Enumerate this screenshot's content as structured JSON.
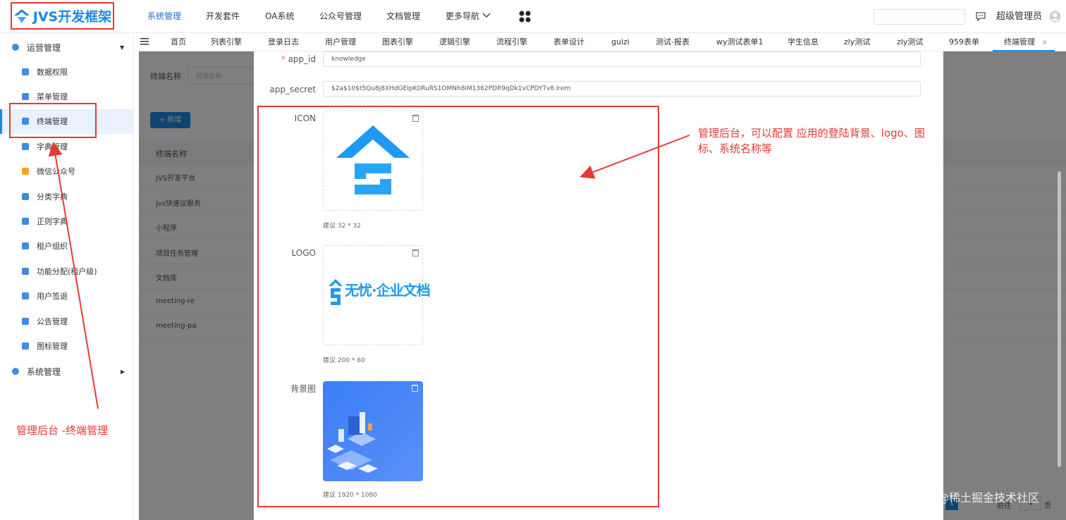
{
  "app": {
    "logo_text": "JVS开发框架"
  },
  "topnav": {
    "items": [
      "系统管理",
      "开发套件",
      "OA系统",
      "公众号管理",
      "文档管理",
      "更多导航"
    ],
    "active": "系统管理",
    "user": "超级管理员"
  },
  "tabs": [
    "首页",
    "列表引擎",
    "登录日志",
    "用户管理",
    "图表引擎",
    "逻辑引擎",
    "流程引擎",
    "表单设计",
    "guizi",
    "测试-报表",
    "wy测试表单1",
    "学生信息",
    "zly测试",
    "zly测试",
    "959表单",
    "终端管理"
  ],
  "sidebar": {
    "group1": "运营管理",
    "items": [
      "数据权限",
      "菜单管理",
      "终端管理",
      "字典管理",
      "微信公众号",
      "分类字典",
      "正则字典",
      "租户组织",
      "功能分配(租户级)",
      "用户签退",
      "公告管理",
      "图标管理"
    ],
    "active_index": 2,
    "icon_colors": [
      "#3a8ee6",
      "#3a8ee6",
      "#3a8ee6",
      "#3a8ee6",
      "#f5a623",
      "#3a8ee6",
      "#3a8ee6",
      "#3a8ee6",
      "#3a8ee6",
      "#3a8ee6",
      "#3a8ee6",
      "#3a8ee6"
    ],
    "group2": "系统管理"
  },
  "list_page": {
    "search_label": "终端名称",
    "search_placeholder": "终端名称",
    "add_button": "+ 新增",
    "column_header": "终端名称",
    "rows": [
      "JVS开发平台",
      "jvs快速议服务",
      "小程序",
      "项目任务管理",
      "文档库",
      "meeting-re",
      "meeting-pa"
    ],
    "pagination": {
      "page": "1",
      "goto": "前往",
      "page_num": "1",
      "page_unit": "页"
    }
  },
  "form": {
    "app_id_label": "app_id",
    "app_id_value": "knowledge",
    "app_secret_label": "app_secret",
    "app_secret_value": "$2a$10$t5Qu8j8XHdGEIpK0RuRS1OMNh8iM1362PDR9qDk1vCPDYTv8.lrem",
    "icon_label": "ICON",
    "icon_hint": "建议 32 * 32",
    "logo_label": "LOGO",
    "logo_image_text": "无忧·企业文档",
    "logo_hint": "建议 200 * 60",
    "bg_label": "背景图",
    "bg_hint": "建议 1920 * 1080"
  },
  "annotations": {
    "right": "管理后台，可以配置 应用的登陆背景、logo、图标、系统名称等",
    "left": "管理后台 -终端管理",
    "color": "#e53935"
  },
  "watermark": "@稀土掘金技术社区"
}
